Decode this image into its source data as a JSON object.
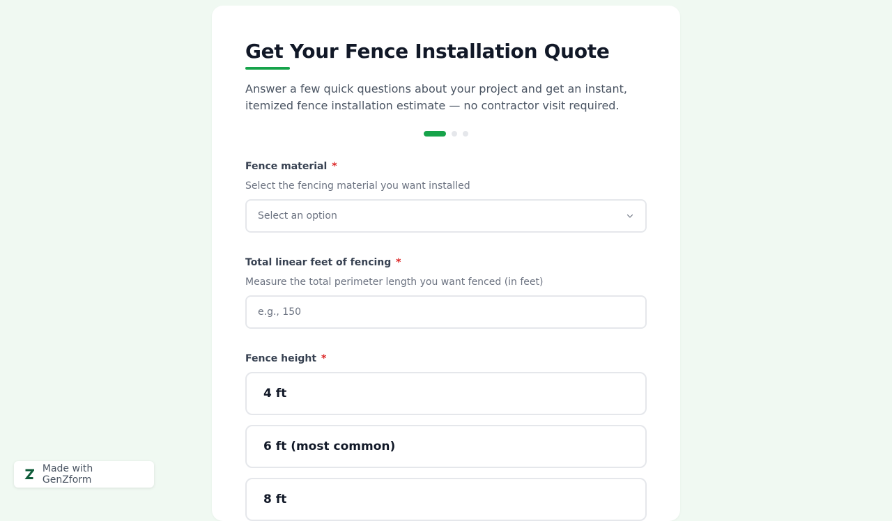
{
  "form": {
    "title": "Get Your Fence Installation Quote",
    "subtitle": "Answer a few quick questions about your project and get an instant, itemized fence installation estimate — no contractor visit required.",
    "progress": {
      "current_step": 1,
      "total_steps": 3
    },
    "accent_color": "#16a34a",
    "required_marker": "*"
  },
  "fields": {
    "material": {
      "label": "Fence material",
      "help": "Select the fencing material you want installed",
      "selected_text": "Select an option"
    },
    "linear_feet": {
      "label": "Total linear feet of fencing",
      "help": "Measure the total perimeter length you want fenced (in feet)",
      "placeholder": "e.g., 150",
      "value": ""
    },
    "height": {
      "label": "Fence height",
      "options": [
        "4 ft",
        "6 ft (most common)",
        "8 ft"
      ]
    }
  },
  "badge": {
    "label": "Made with GenZform",
    "logo_icon": "genzform-z-logo",
    "logo_color": "#0f5c3a"
  }
}
